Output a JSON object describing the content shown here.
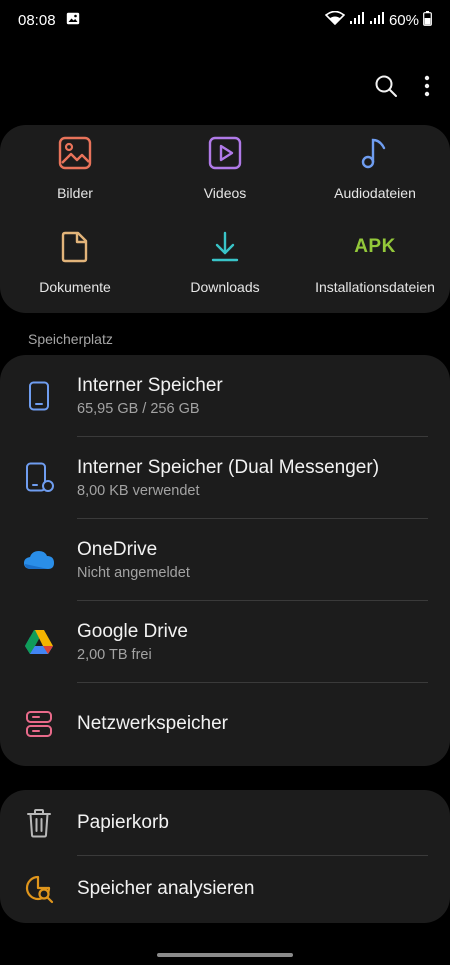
{
  "status_bar": {
    "time": "08:08",
    "battery": "60%",
    "icons": [
      "gallery-notification-icon",
      "wifi-icon",
      "signal-icon",
      "signal-icon",
      "battery-icon"
    ]
  },
  "toolbar": {
    "icons": [
      "search-icon",
      "more-options-icon"
    ]
  },
  "categories": [
    {
      "label": "Bilder",
      "icon": "image-icon",
      "color": "#e8735a"
    },
    {
      "label": "Videos",
      "icon": "video-icon",
      "color": "#b07ae8"
    },
    {
      "label": "Audiodateien",
      "icon": "music-note-icon",
      "color": "#6f9df0"
    },
    {
      "label": "Dokumente",
      "icon": "document-icon",
      "color": "#e2b47a"
    },
    {
      "label": "Downloads",
      "icon": "download-icon",
      "color": "#39c4c8"
    },
    {
      "label": "Installationsdateien",
      "icon": "apk-icon",
      "icon_text": "APK",
      "color": "#93c83a"
    }
  ],
  "storage_section": {
    "title": "Speicherplatz",
    "items": [
      {
        "title": "Interner Speicher",
        "subtitle": "65,95 GB / 256 GB",
        "icon": "phone-icon"
      },
      {
        "title": "Interner Speicher (Dual Messenger)",
        "subtitle": "8,00 KB verwendet",
        "icon": "dual-messenger-phone-icon"
      },
      {
        "title": "OneDrive",
        "subtitle": "Nicht angemeldet",
        "icon": "onedrive-icon"
      },
      {
        "title": "Google Drive",
        "subtitle": "2,00 TB frei",
        "icon": "google-drive-icon"
      },
      {
        "title": "Netzwerkspeicher",
        "subtitle": "",
        "icon": "network-storage-icon"
      }
    ]
  },
  "bottom_items": [
    {
      "title": "Papierkorb",
      "icon": "trash-icon"
    },
    {
      "title": "Speicher analysieren",
      "icon": "storage-analyze-icon"
    }
  ]
}
